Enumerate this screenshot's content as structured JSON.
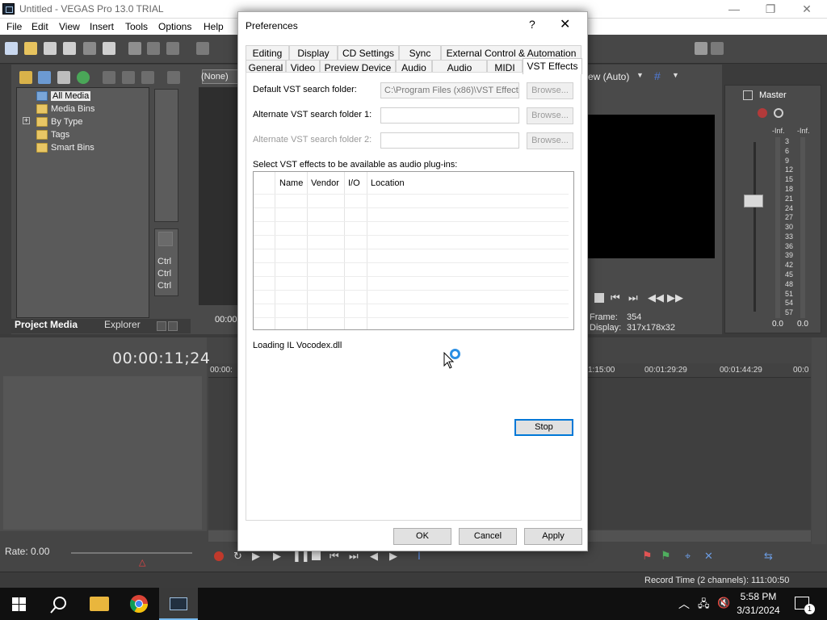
{
  "window": {
    "title": "Untitled - VEGAS Pro 13.0 TRIAL",
    "minimize": "—",
    "maximize": "❐",
    "close": "✕"
  },
  "menu": [
    "File",
    "Edit",
    "View",
    "Insert",
    "Tools",
    "Options",
    "Help"
  ],
  "explorer": {
    "media_tree": [
      "All Media",
      "Media Bins",
      "By Type",
      "Tags",
      "Smart Bins"
    ],
    "tabs": [
      "Project Media",
      "Explorer"
    ],
    "none_dropdown": "(None)",
    "trimmer_shortcuts": [
      "Ctrl",
      "Ctrl",
      "Ctrl"
    ],
    "trimmer_time": "00:00"
  },
  "preview": {
    "quality": "ew (Auto)",
    "frame_label": "Frame:",
    "frame_value": "354",
    "display_label": "Display:",
    "display_value": "317x178x32"
  },
  "master": {
    "label": "Master",
    "left_peak": "-Inf.",
    "right_peak": "-Inf.",
    "scale": [
      "3",
      "6",
      "9",
      "12",
      "15",
      "18",
      "21",
      "24",
      "27",
      "30",
      "33",
      "36",
      "39",
      "42",
      "45",
      "48",
      "51",
      "54",
      "57"
    ],
    "left_value": "0.0",
    "right_value": "0.0"
  },
  "timeline": {
    "timecode": "00:00:11;24",
    "ruler": [
      "00:00:",
      "1:15:00",
      "00:01:29:29",
      "00:01:44:29",
      "00:0"
    ],
    "rate": "Rate: 0.00",
    "record_time": "Record Time (2 channels): 111:00:50"
  },
  "dialog": {
    "title": "Preferences",
    "help": "?",
    "close": "✕",
    "tabs_row1": [
      "Editing",
      "Display",
      "CD Settings",
      "Sync",
      "External Control & Automation"
    ],
    "tabs_row2": [
      "General",
      "Video",
      "Preview Device",
      "Audio",
      "Audio Device",
      "MIDI",
      "VST Effects"
    ],
    "default_folder_label": "Default VST search folder:",
    "default_folder_value": "C:\\Program Files (x86)\\VST Effects",
    "alt1_label": "Alternate VST search folder 1:",
    "alt2_label": "Alternate VST search folder 2:",
    "browse": "Browse...",
    "select_label": "Select VST effects to be available as audio plug-ins:",
    "columns": [
      "Name",
      "Vendor",
      "I/O",
      "Location"
    ],
    "loading": "Loading IL Vocodex.dll",
    "stop": "Stop",
    "ok": "OK",
    "cancel": "Cancel",
    "apply": "Apply"
  },
  "taskbar": {
    "time": "5:58 PM",
    "date": "3/31/2024",
    "notification_count": "1"
  }
}
